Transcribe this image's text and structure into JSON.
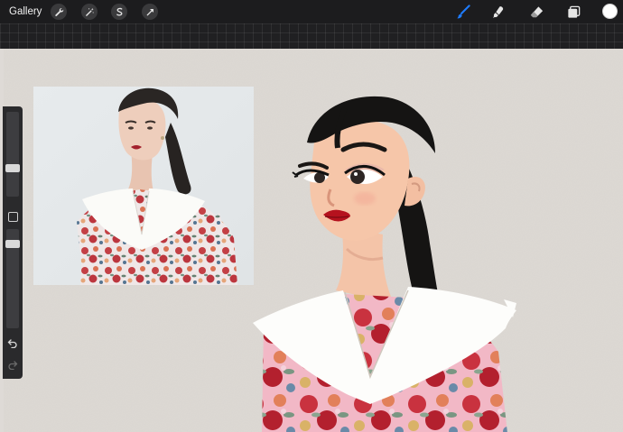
{
  "toolbar": {
    "gallery_label": "Gallery",
    "left_tools": [
      "wrench-icon",
      "magic-wand-icon",
      "selection-icon",
      "transform-arrow-icon"
    ],
    "right_tools": [
      "brush-icon",
      "smudge-icon",
      "eraser-icon",
      "layers-icon"
    ],
    "active_tool": "brush-icon",
    "accent_color": "#1e7cff",
    "current_color": "#ffffff"
  },
  "sidebar": {
    "brush_size_level": 0.46,
    "opacity_level": 0.58,
    "buttons": [
      "modify-square-icon",
      "undo-icon",
      "redo-icon"
    ]
  },
  "canvas": {
    "background_color": "#dcd8d3"
  }
}
